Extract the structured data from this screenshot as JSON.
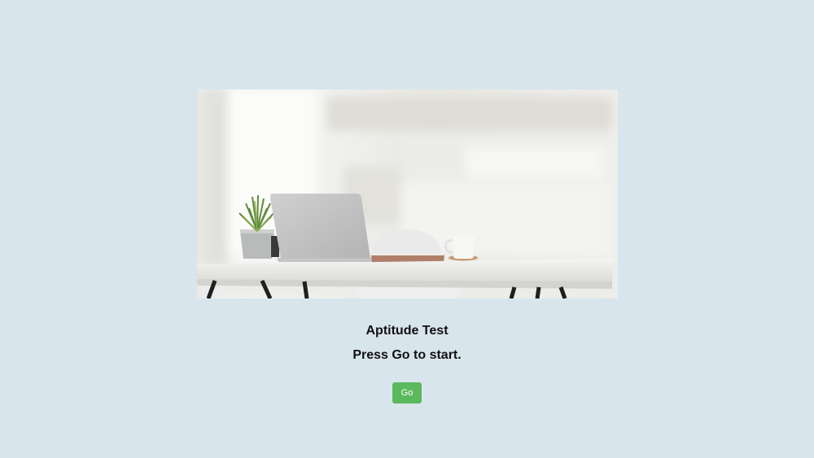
{
  "main": {
    "title": "Aptitude Test",
    "subtitle": "Press Go to start.",
    "go_label": "Go"
  },
  "colors": {
    "background": "#d9e5ec",
    "button": "#5cb85c",
    "button_text": "#ffffff"
  }
}
